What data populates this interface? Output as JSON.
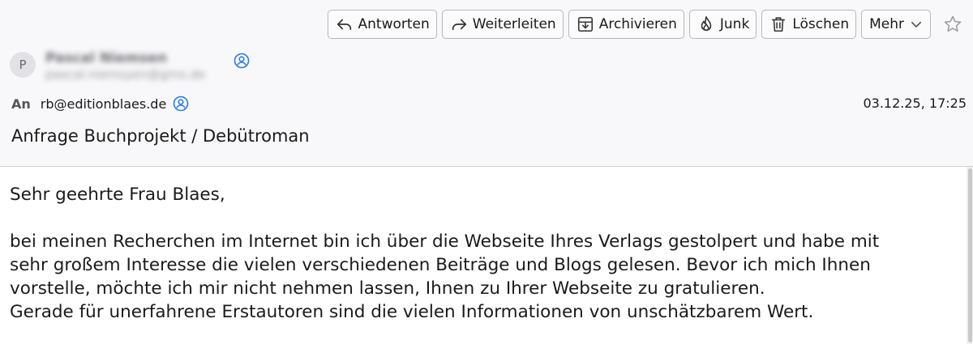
{
  "toolbar": {
    "reply": "Antworten",
    "forward": "Weiterleiten",
    "archive": "Archivieren",
    "junk": "Junk",
    "delete": "Löschen",
    "more": "Mehr"
  },
  "sender": {
    "initial": "P",
    "name": "Pascal Niemsen",
    "email": "pascal.niemsyen@gmx.de"
  },
  "recipient": {
    "label": "An",
    "address": "rb@editionblaes.de"
  },
  "date": "03.12.25, 17:25",
  "subject": "Anfrage Buchprojekt / Debütroman",
  "body": {
    "greeting": "Sehr geehrte Frau Blaes,",
    "paragraph": "bei meinen Recherchen im Internet bin ich über die Webseite Ihres Verlags gestolpert und habe mit\nsehr großem Interesse die vielen verschiedenen Beiträge und Blogs gelesen. Bevor ich mich Ihnen\nvorstelle, möchte ich mir nicht nehmen lassen, Ihnen zu Ihrer Webseite zu gratulieren.\nGerade für unerfahrene Erstautoren sind die vielen Informationen von unschätzbarem Wert."
  },
  "colors": {
    "contact_icon": "#2a7ce6",
    "header_bg": "#f8f8fa"
  }
}
